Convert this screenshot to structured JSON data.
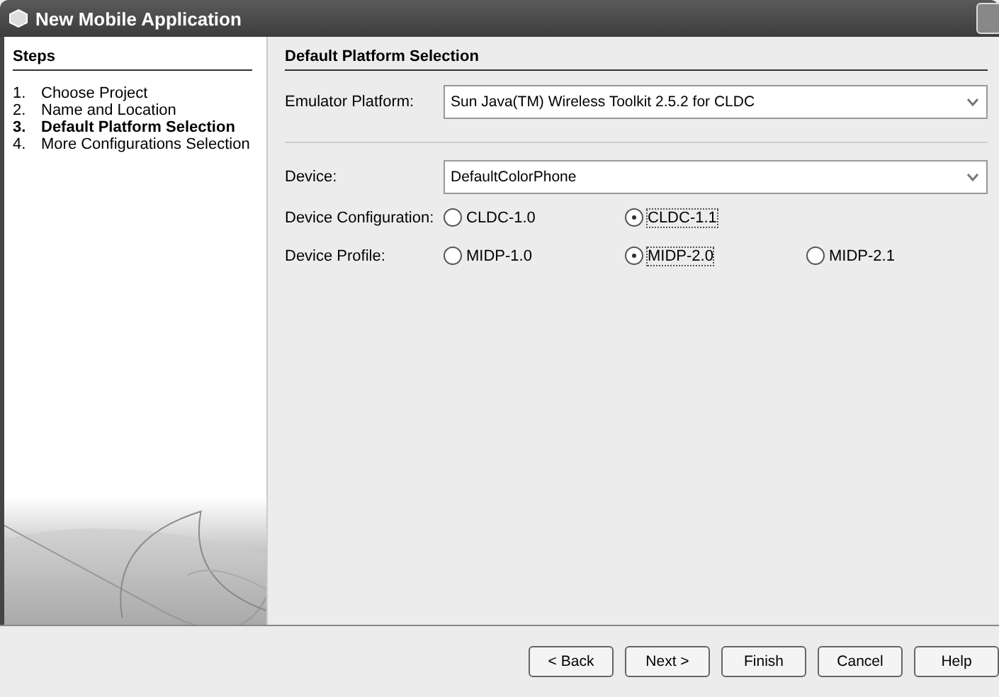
{
  "window": {
    "title": "New Mobile Application"
  },
  "steps": {
    "title": "Steps",
    "items": [
      {
        "number": "1.",
        "label": "Choose Project",
        "selected": false
      },
      {
        "number": "2.",
        "label": "Name and Location",
        "selected": false
      },
      {
        "number": "3.",
        "label": "Default Platform Selection",
        "selected": true
      },
      {
        "number": "4.",
        "label": "More Configurations Selection",
        "selected": false
      }
    ]
  },
  "panel": {
    "title": "Default Platform Selection",
    "emulator": {
      "label": "Emulator Platform:",
      "value": "Sun Java(TM) Wireless Toolkit 2.5.2 for CLDC"
    },
    "device": {
      "label": "Device:",
      "value": "DefaultColorPhone"
    },
    "radio_groups": [
      {
        "label": "Device Configuration:",
        "options": [
          {
            "label": "CLDC-1.0",
            "selected": false
          },
          {
            "label": "CLDC-1.1",
            "selected": true
          }
        ]
      },
      {
        "label": "Device Profile:",
        "options": [
          {
            "label": "MIDP-1.0",
            "selected": false
          },
          {
            "label": "MIDP-2.0",
            "selected": true
          },
          {
            "label": "MIDP-2.1",
            "selected": false
          }
        ]
      }
    ]
  },
  "buttons": [
    "< Back",
    "Next >",
    "Finish",
    "Cancel",
    "Help"
  ]
}
